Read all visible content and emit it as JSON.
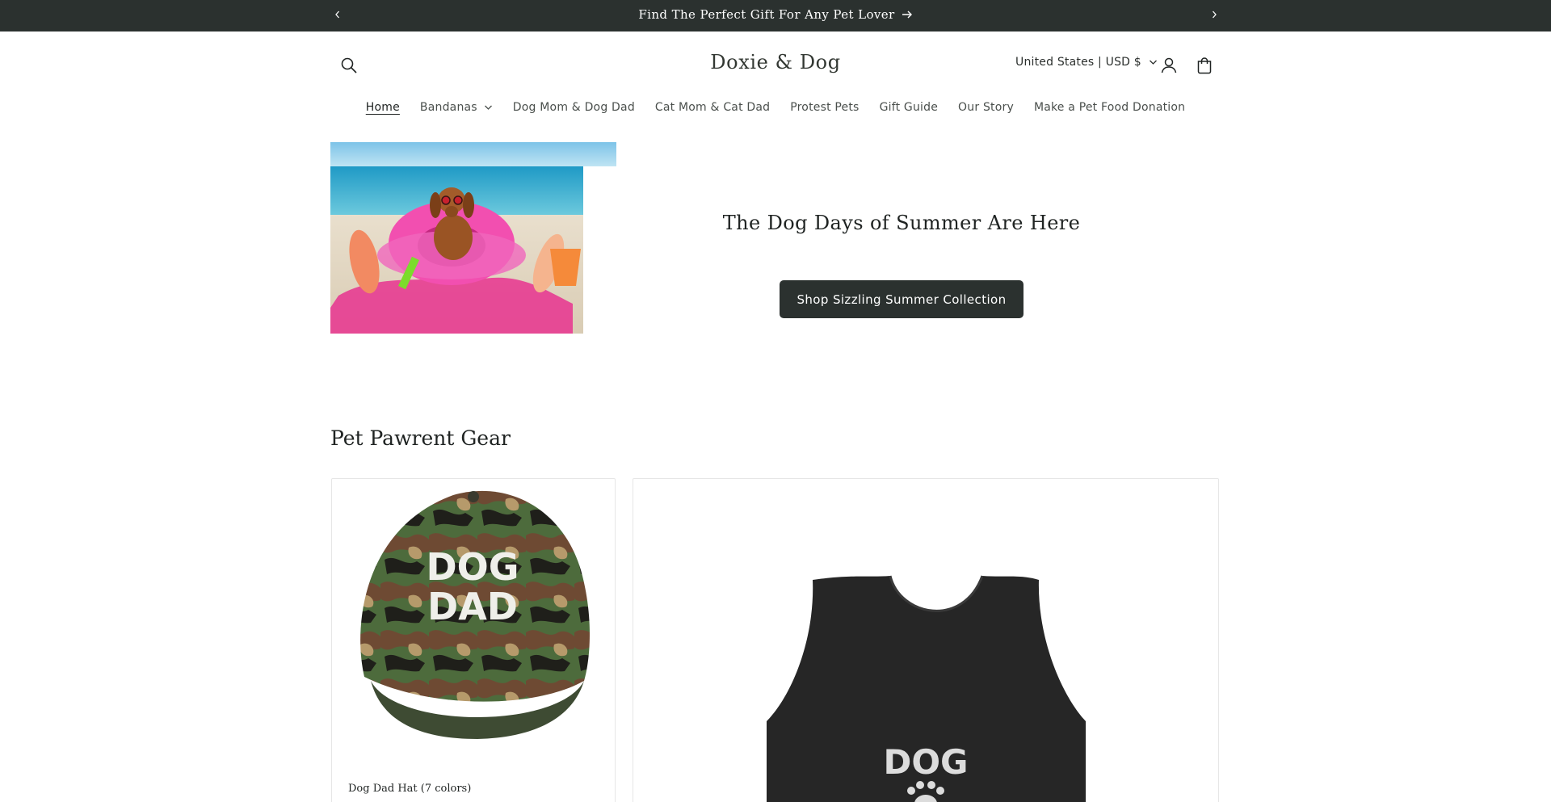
{
  "announcement": {
    "text": "Find The Perfect Gift For Any Pet Lover",
    "icons": {
      "prev": "chevron-left-icon",
      "next": "chevron-right-icon",
      "link": "arrow-right-icon"
    }
  },
  "header": {
    "logo": "Doxie & Dog",
    "currency": "United States | USD $",
    "icons": {
      "search": "search-icon",
      "account": "user-icon",
      "cart": "cart-icon"
    }
  },
  "nav": {
    "items": [
      {
        "label": "Home",
        "active": true
      },
      {
        "label": "Bandanas",
        "has_dropdown": true
      },
      {
        "label": "Dog Mom & Dog Dad"
      },
      {
        "label": "Cat Mom & Cat Dad"
      },
      {
        "label": "Protest Pets"
      },
      {
        "label": "Gift Guide"
      },
      {
        "label": "Our Story"
      },
      {
        "label": "Make a Pet Food Donation"
      }
    ]
  },
  "hero": {
    "title": "The Dog Days of Summer Are Here",
    "button": "Shop Sizzling Summer Collection"
  },
  "collection": {
    "title": "Pet Pawrent Gear",
    "products": [
      {
        "title": "Dog Dad Hat (7 colors)",
        "image_text": [
          "DOG",
          "DAD"
        ]
      },
      {
        "title": "",
        "image_text": [
          "DOG"
        ]
      }
    ]
  },
  "colors": {
    "announcement_bg": "#2b312f",
    "button_bg": "#2b312f",
    "text": "#1f2322"
  }
}
